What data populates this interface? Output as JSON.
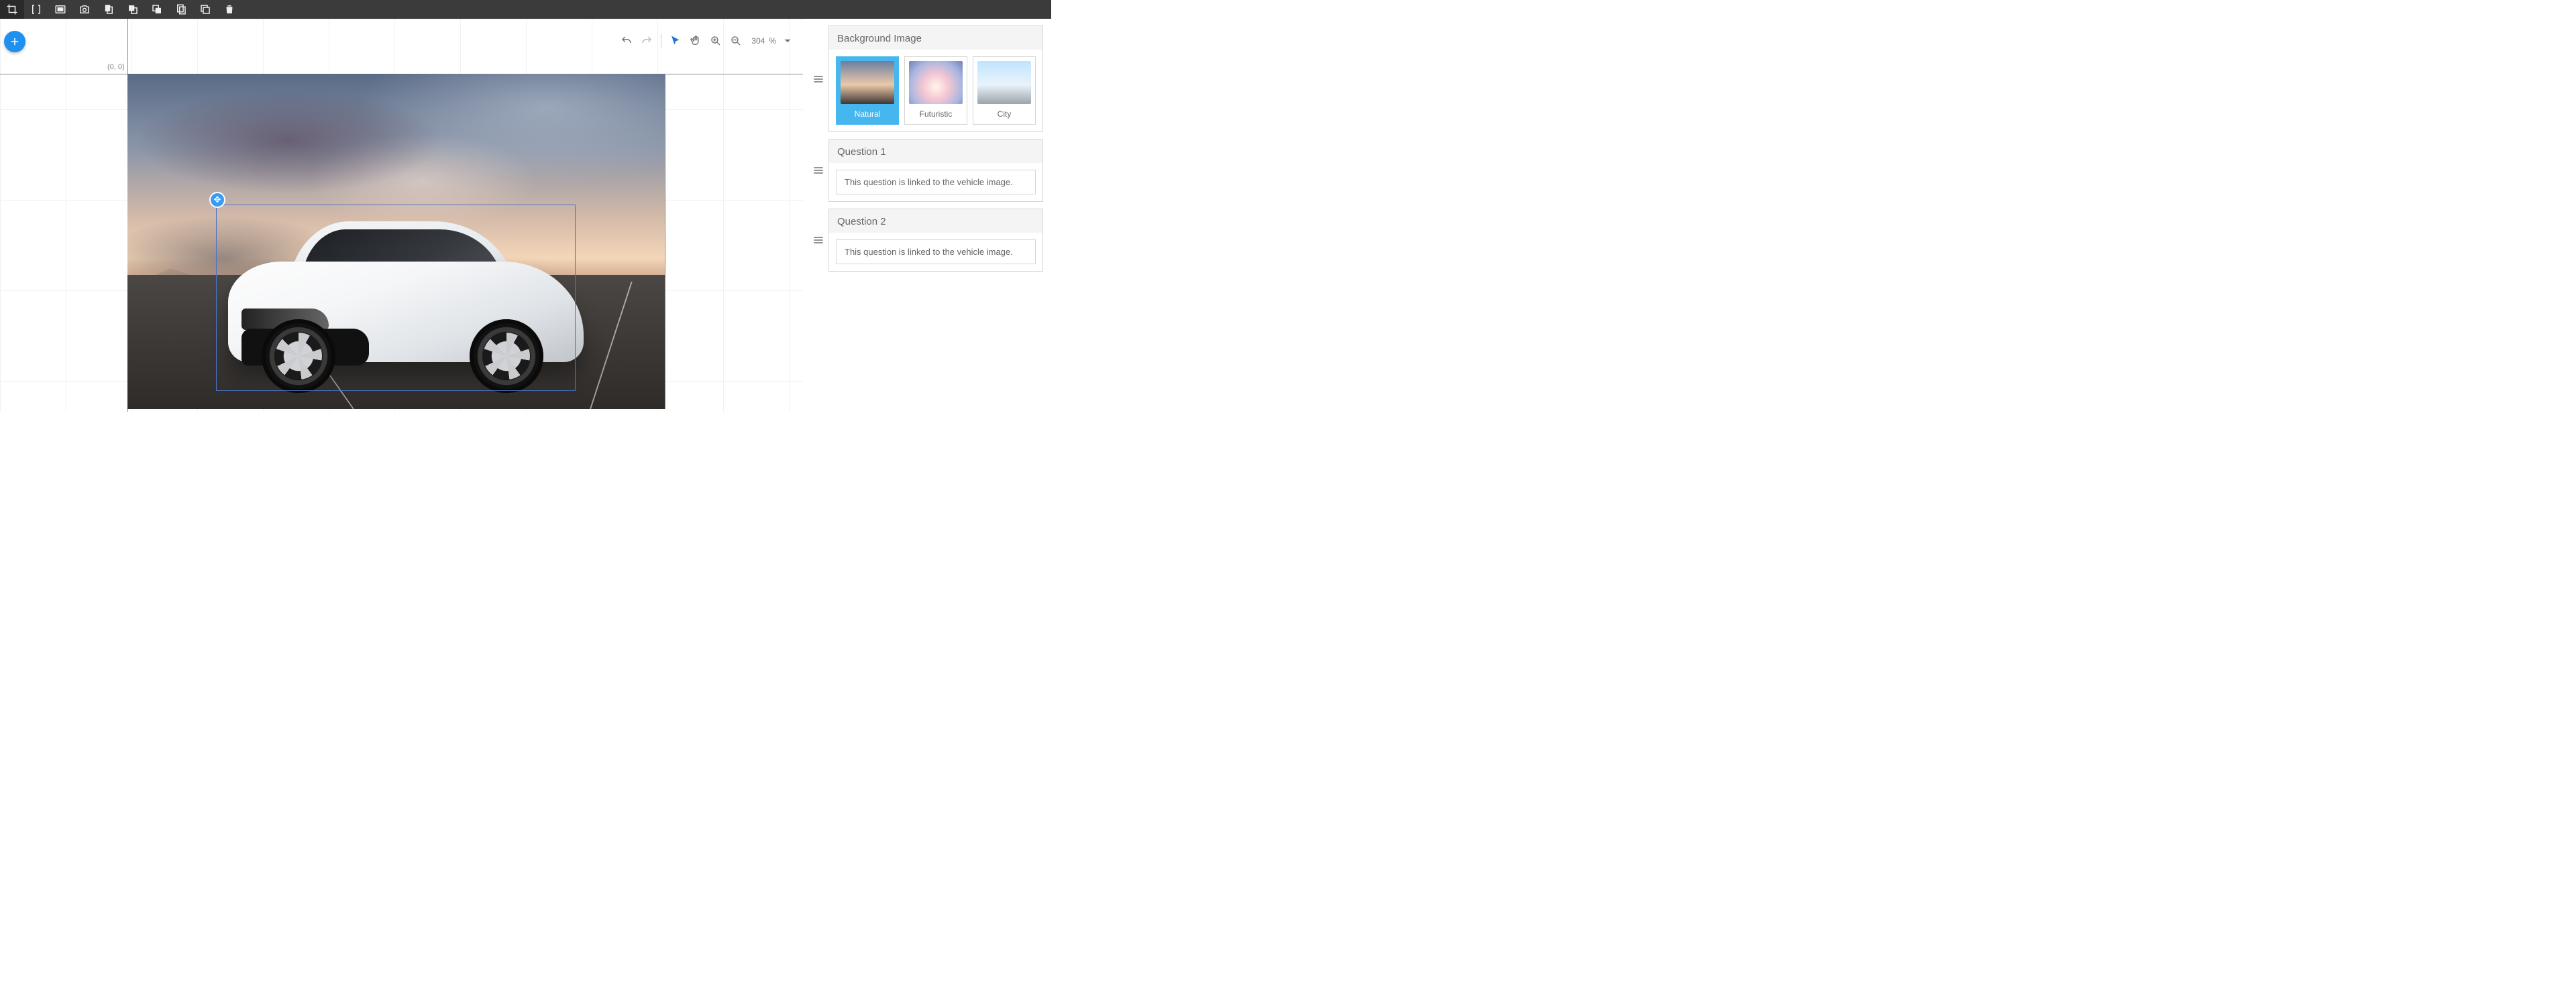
{
  "toolbar": {
    "icons": [
      "crop-icon",
      "brackets-icon",
      "fit-icon",
      "camera-icon",
      "copy-pages-icon",
      "bring-front-icon",
      "send-back-icon",
      "duplicate-icon",
      "copy-icon",
      "trash-icon"
    ],
    "active_index": 0
  },
  "canvas": {
    "origin_label": "(0, 0)",
    "selection": {
      "present": true
    }
  },
  "view_toolbar": {
    "zoom_value": "304",
    "zoom_unit": "%"
  },
  "right_panel": {
    "background": {
      "title": "Background Image",
      "options": [
        {
          "label": "Natural",
          "kind": "natural",
          "selected": true
        },
        {
          "label": "Futuristic",
          "kind": "futuristic",
          "selected": false
        },
        {
          "label": "City",
          "kind": "city",
          "selected": false
        }
      ]
    },
    "questions": [
      {
        "title": "Question 1",
        "note": "This question is linked to the vehicle image."
      },
      {
        "title": "Question 2",
        "note": "This question is linked to the vehicle image."
      }
    ]
  }
}
